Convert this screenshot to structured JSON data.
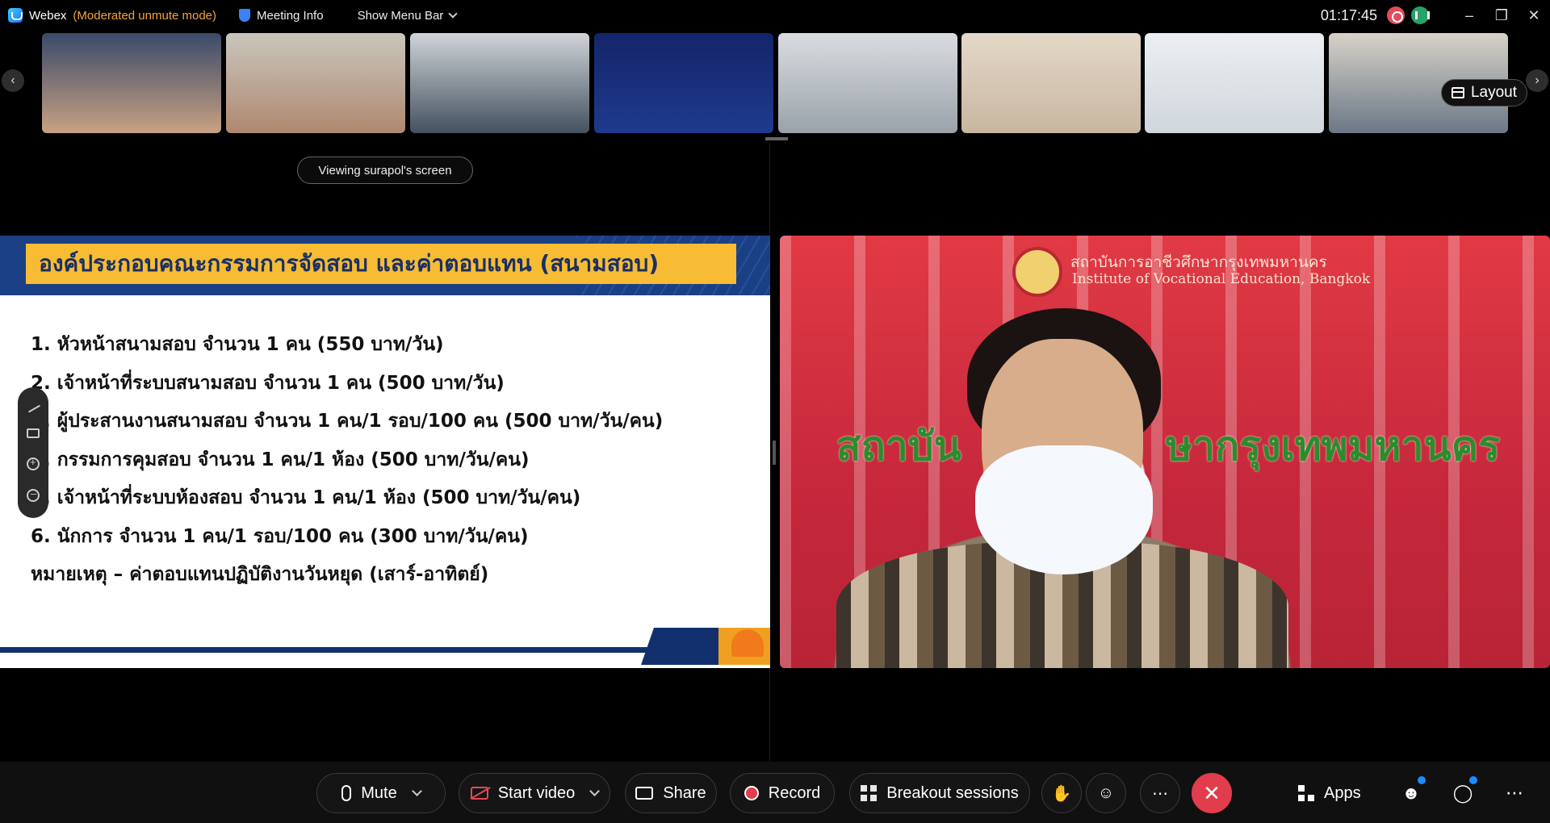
{
  "titlebar": {
    "app_name": "Webex",
    "mode": "(Moderated unmute mode)",
    "meeting_info": "Meeting Info",
    "show_menu_bar": "Show Menu Bar",
    "clock": "01:17:45"
  },
  "filmstrip": {
    "layout_label": "Layout",
    "thumbnails": [
      {
        "name": "participant-1",
        "colors": [
          "#3a4a6a",
          "#c9a182"
        ]
      },
      {
        "name": "participant-2",
        "colors": [
          "#c9c6bc",
          "#b08870"
        ]
      },
      {
        "name": "participant-3",
        "colors": [
          "#cfd4d8",
          "#44515f"
        ]
      },
      {
        "name": "participant-4-obs",
        "colors": [
          "#14256a",
          "#1e3a8c"
        ]
      },
      {
        "name": "participant-5",
        "colors": [
          "#d9dde0",
          "#9aa2aa"
        ]
      },
      {
        "name": "participant-6",
        "colors": [
          "#e4d8c8",
          "#c8b6a0"
        ]
      },
      {
        "name": "participant-7",
        "colors": [
          "#eceff2",
          "#cfd6dc"
        ]
      },
      {
        "name": "participant-8",
        "colors": [
          "#d7d2c8",
          "#6b7887"
        ]
      }
    ]
  },
  "share": {
    "viewing_label": "Viewing surapol's screen",
    "slide_title": "องค์ประกอบคณะกรรมการจัดสอบ และค่าตอบแทน (สนามสอบ)",
    "lines": [
      "1. หัวหน้าสนามสอบ จำนวน 1 คน (550 บาท/วัน)",
      "2. เจ้าหน้าที่ระบบสนามสอบ จำนวน 1 คน (500 บาท/วัน)",
      "3. ผู้ประสานงานสนามสอบ จำนวน 1 คน/1 รอบ/100 คน (500 บาท/วัน/คน)",
      "4. กรรมการคุมสอบ จำนวน 1 คน/1 ห้อง (500 บาท/วัน/คน)",
      "5. เจ้าหน้าที่ระบบห้องสอบ จำนวน 1 คน/1 ห้อง (500 บาท/วัน/คน)",
      "6. นักการ จำนวน 1 คน/1 รอบ/100 คน (300 บาท/วัน/คน)",
      "หมายเหตุ – ค่าตอบแทนปฏิบัติงานวันหยุด (เสาร์-อาทิตย์)"
    ]
  },
  "speaker": {
    "org_th": "สถาบันการอาชีวศึกษากรุงเทพมหานคร",
    "org_en": "Institute of Vocational Education, Bangkok",
    "banner_left": "สถาบัน",
    "banner_right": "ษากรุงเทพมหานคร"
  },
  "controls": {
    "mute": "Mute",
    "start_video": "Start video",
    "share": "Share",
    "record": "Record",
    "breakout": "Breakout sessions",
    "apps": "Apps"
  }
}
